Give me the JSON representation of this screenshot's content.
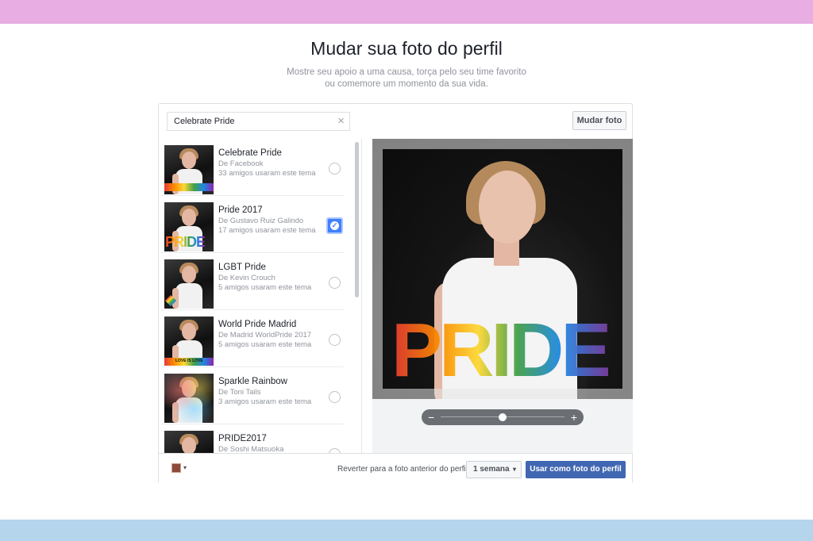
{
  "page": {
    "title": "Mudar sua foto do perfil",
    "subtitle_line1": "Mostre seu apoio a uma causa, torça pelo seu time favorito",
    "subtitle_line2": "ou comemore um momento da sua vida."
  },
  "search": {
    "value": "Celebrate Pride",
    "clear_icon": "×"
  },
  "toolbar": {
    "change_photo_label": "Mudar foto"
  },
  "frames": [
    {
      "title": "Celebrate Pride",
      "by": "De Facebook",
      "count": "33 amigos usaram este tema",
      "selected": false
    },
    {
      "title": "Pride 2017",
      "by": "De Gustavo Ruiz Galindo",
      "count": "17 amigos usaram este tema",
      "selected": true
    },
    {
      "title": "LGBT Pride",
      "by": "De Kevin Crouch",
      "count": "5 amigos usaram este tema",
      "selected": false
    },
    {
      "title": "World Pride Madrid",
      "by": "De Madrid WorldPride 2017",
      "count": "5 amigos usaram este tema",
      "selected": false,
      "overlay_text": "LOVE IS LOVE"
    },
    {
      "title": "Sparkle Rainbow",
      "by": "De Toni Tails",
      "count": "3 amigos usaram este tema",
      "selected": false
    },
    {
      "title": "PRIDE2017",
      "by": "De Soshi Matsuoka",
      "count": "",
      "selected": false
    }
  ],
  "preview": {
    "overlay_text": "PRIDE",
    "zoom": {
      "minus": "−",
      "plus": "+",
      "level": 0.5
    }
  },
  "footer": {
    "privacy_caret": "▾",
    "revert_label": "Reverter para a foto anterior do perfil",
    "duration_value": "1 semana",
    "duration_caret": "▾",
    "primary_label": "Usar como foto do perfil"
  },
  "colors": {
    "top_band": "#e8ade3",
    "bottom_band": "#b4d5ec",
    "primary": "#4267b2",
    "selected_check": "#4080ff"
  },
  "icons": {
    "search_clear": "close-icon",
    "selected": "check-icon",
    "privacy": "avatar-icon"
  }
}
